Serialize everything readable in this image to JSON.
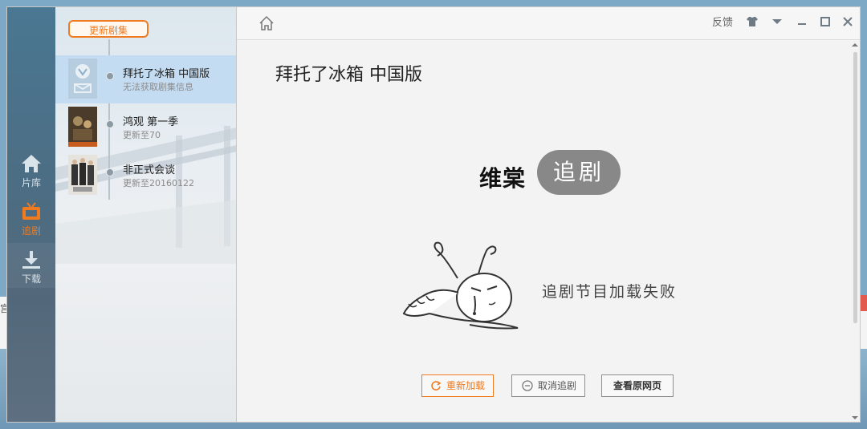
{
  "nav": {
    "items": [
      {
        "label": "片库",
        "icon": "home-icon"
      },
      {
        "label": "追剧",
        "icon": "tv-icon"
      },
      {
        "label": "下载",
        "icon": "download-icon"
      }
    ]
  },
  "list": {
    "update_label": "更新剧集",
    "shows": [
      {
        "title": "拜托了冰箱 中国版",
        "subtitle": "无法获取剧集信息"
      },
      {
        "title": "鸿观 第一季",
        "subtitle": "更新至70"
      },
      {
        "title": "非正式会谈",
        "subtitle": "更新至20160122"
      }
    ]
  },
  "topbar": {
    "feedback_label": "反馈"
  },
  "content": {
    "title": "拜托了冰箱 中国版",
    "logo_text": "维棠",
    "logo_badge": "追剧",
    "error_message": "追剧节目加载失败",
    "buttons": {
      "reload": "重新加载",
      "cancel": "取消追剧",
      "view_page": "查看原网页"
    }
  },
  "desktop": {
    "fragment_left": "宫"
  },
  "colors": {
    "accent": "#f07a1f",
    "nav_bg": "#4c6d83",
    "selected_row": "#c4dcf2"
  }
}
